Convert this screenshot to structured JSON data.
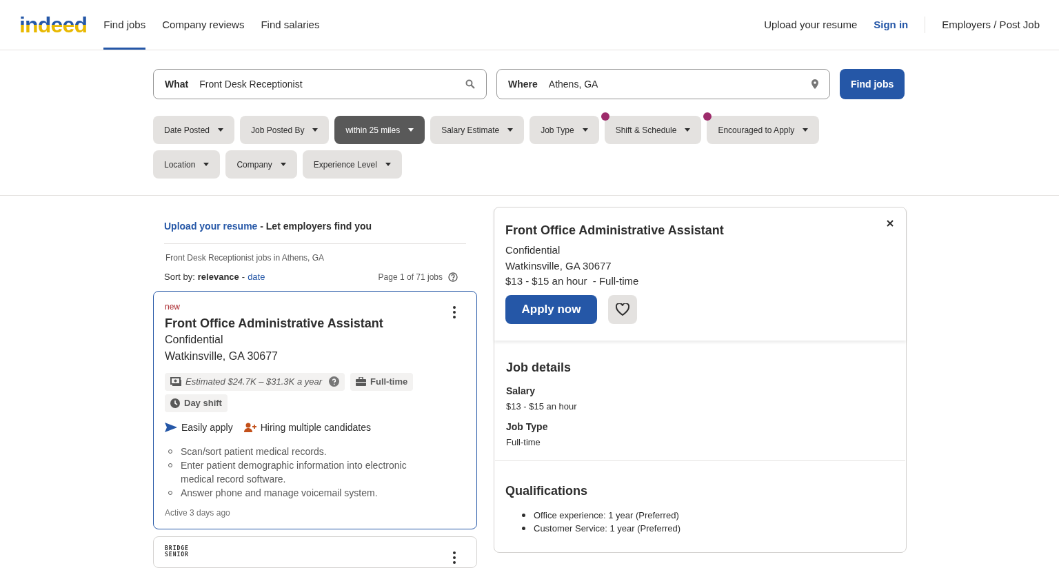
{
  "header": {
    "logo": "indeed",
    "nav": [
      {
        "label": "Find jobs",
        "selected": true
      },
      {
        "label": "Company reviews",
        "selected": false
      },
      {
        "label": "Find salaries",
        "selected": false
      }
    ],
    "upload": "Upload your resume",
    "sign_in": "Sign in",
    "employers": "Employers / Post Job"
  },
  "search": {
    "what_label": "What",
    "what_value": "Front Desk Receptionist",
    "where_label": "Where",
    "where_value": "Athens, GA",
    "button": "Find jobs"
  },
  "filters": [
    {
      "label": "Date Posted",
      "selected": false,
      "dot": false
    },
    {
      "label": "Job Posted By",
      "selected": false,
      "dot": false
    },
    {
      "label": "within 25 miles",
      "selected": true,
      "dot": false
    },
    {
      "label": "Salary Estimate",
      "selected": false,
      "dot": false
    },
    {
      "label": "Job Type",
      "selected": false,
      "dot": false
    },
    {
      "label": "Shift & Schedule",
      "selected": false,
      "dot": true
    },
    {
      "label": "Encouraged to Apply",
      "selected": false,
      "dot": true
    },
    {
      "label": "Location",
      "selected": false,
      "dot": false
    },
    {
      "label": "Company",
      "selected": false,
      "dot": false
    },
    {
      "label": "Experience Level",
      "selected": false,
      "dot": false
    }
  ],
  "results": {
    "upload_link": "Upload your resume",
    "upload_text": "- Let employers find you",
    "heading": "Front Desk Receptionist jobs in Athens, GA",
    "sort_label": "Sort by:",
    "sort_current": "relevance",
    "sort_sep": "-",
    "sort_other": "date",
    "page_info": "Page 1 of 71 jobs",
    "jobs": [
      {
        "badge": "new",
        "title": "Front Office Administrative Assistant",
        "company": "Confidential",
        "location": "Watkinsville, GA 30677",
        "selected": true,
        "tags": [
          {
            "kind": "salary",
            "text": "Estimated $24.7K – $31.3K a year"
          },
          {
            "kind": "type",
            "text": "Full-time"
          },
          {
            "kind": "shift",
            "text": "Day shift"
          }
        ],
        "features": [
          {
            "kind": "apply",
            "text": "Easily apply"
          },
          {
            "kind": "hiring",
            "text": "Hiring multiple candidates"
          }
        ],
        "bullets": [
          "Scan/sort patient medical records.",
          "Enter patient demographic information into electronic medical record software.",
          "Answer phone and manage voicemail system."
        ],
        "activity": "Active 3 days ago"
      },
      {
        "logo_lines": [
          "BRIDGE",
          "SENIOR"
        ],
        "selected": false
      }
    ]
  },
  "detail": {
    "title": "Front Office Administrative Assistant",
    "company": "Confidential",
    "location": "Watkinsville, GA 30677",
    "pay": "$13 - $15 an hour  - Full-time",
    "apply": "Apply now",
    "details_heading": "Job details",
    "details": [
      {
        "label": "Salary",
        "value": "$13 - $15 an hour"
      },
      {
        "label": "Job Type",
        "value": "Full-time"
      }
    ],
    "qual_heading": "Qualifications",
    "qualifications": [
      "Office experience: 1 year (Preferred)",
      "Customer Service: 1 year (Preferred)"
    ]
  }
}
